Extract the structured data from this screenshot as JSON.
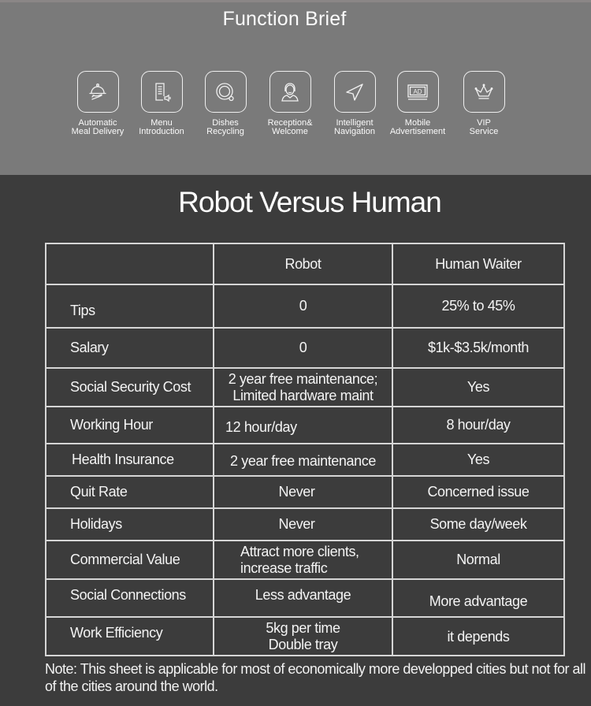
{
  "function_brief": {
    "title": "Function Brief",
    "features": [
      {
        "icon": "meal-delivery-cloche-icon",
        "label_line1": "Automatic",
        "label_line2": "Meal Delivery"
      },
      {
        "icon": "menu-speaker-icon",
        "label_line1": "Menu",
        "label_line2": "Introduction"
      },
      {
        "icon": "dish-recycle-icon",
        "label_line1": "Dishes",
        "label_line2": "Recycling"
      },
      {
        "icon": "receptionist-icon",
        "label_line1": "Reception&",
        "label_line2": "Welcome"
      },
      {
        "icon": "navigation-arrow-icon",
        "label_line1": "Intelligent",
        "label_line2": "Navigation"
      },
      {
        "icon": "ad-screen-icon",
        "ad_text": "AD",
        "label_line1": "Mobile",
        "label_line2": "Advertisement"
      },
      {
        "icon": "crown-icon",
        "label_line1": "VIP",
        "label_line2": "Service"
      }
    ]
  },
  "comparison": {
    "title": "Robot Versus Human",
    "headers": [
      "",
      "Robot",
      "Human Waiter"
    ],
    "rows": [
      {
        "label": "Tips",
        "robot": "0",
        "human": "25% to 45%"
      },
      {
        "label": "Salary",
        "robot": "0",
        "human": "$1k-$3.5k/month"
      },
      {
        "label": "Social Security Cost",
        "robot": "2 year free maintenance;",
        "robot_line2": "Limited hardware maint",
        "human": "Yes"
      },
      {
        "label": "Working Hour",
        "robot": "12 hour/day",
        "human": "8 hour/day"
      },
      {
        "label": "Health Insurance",
        "robot": "2 year free maintenance",
        "human": "Yes"
      },
      {
        "label": "Quit Rate",
        "robot": "Never",
        "human": "Concerned issue"
      },
      {
        "label": "Holidays",
        "robot": "Never",
        "human": "Some day/week"
      },
      {
        "label": "Commercial Value",
        "robot": "Attract more clients,",
        "robot_line2": "increase traffic",
        "human": "Normal"
      },
      {
        "label": "Social Connections",
        "robot": "Less advantage",
        "human": "More advantage"
      },
      {
        "label": "Work Efficiency",
        "robot": "5kg per time",
        "robot_line2": "Double tray",
        "human": "it depends"
      }
    ]
  },
  "note": "Note: This sheet is applicable for most of economically more developped cities but not for all of the cities around the world.",
  "colors": {
    "top_band": "#7a7a7a",
    "background": "#3c3c3c",
    "table_border": "#d6d6d6",
    "text": "#f4f4f4"
  }
}
